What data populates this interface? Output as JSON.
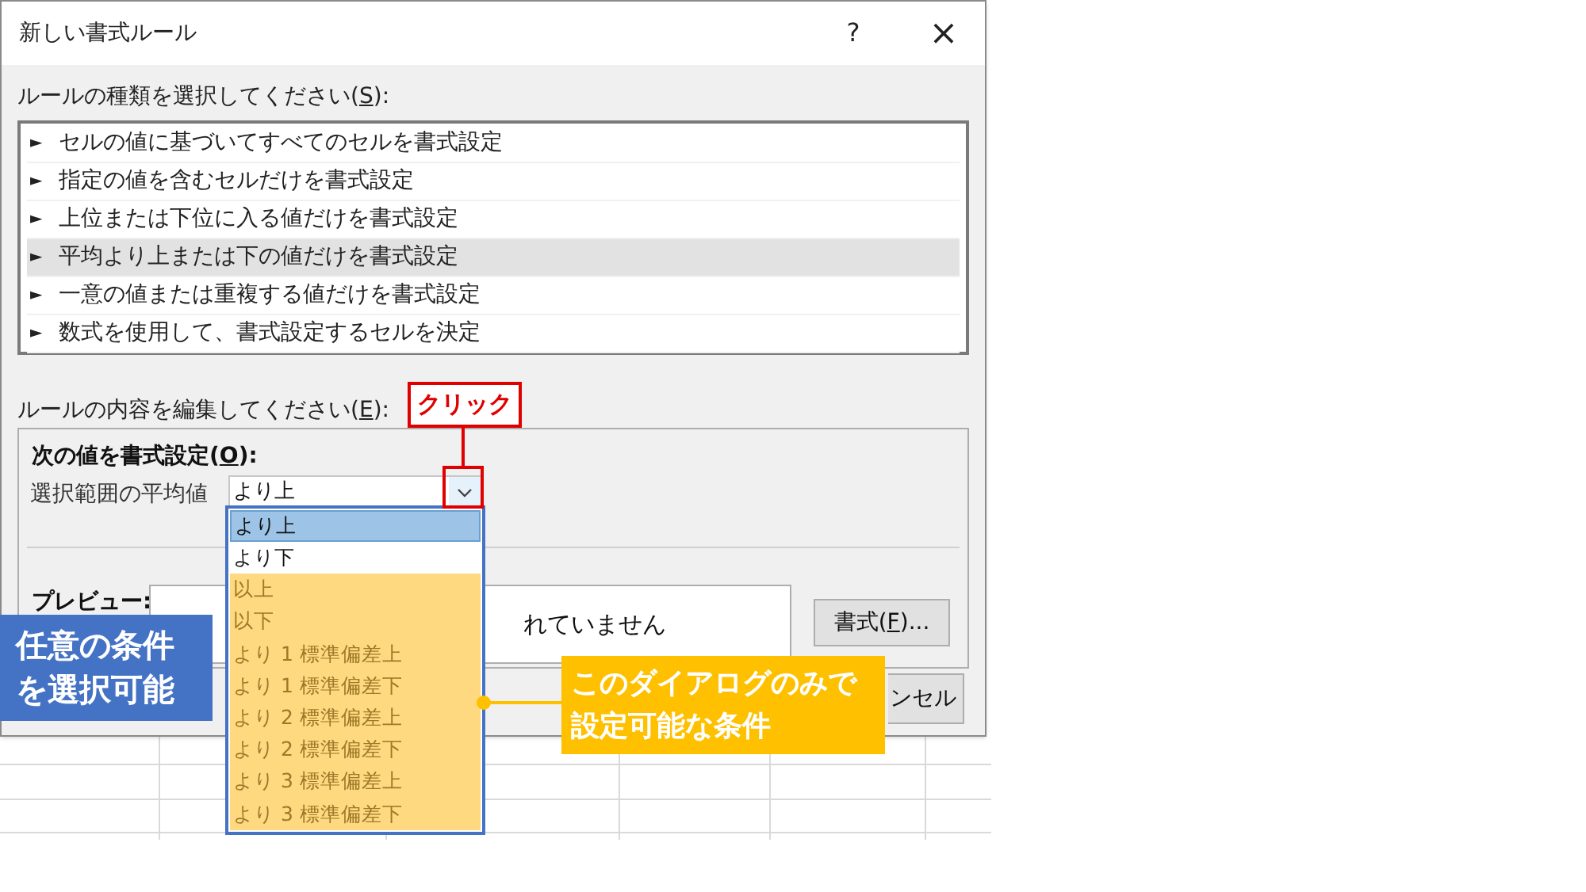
{
  "window": {
    "title": "新しい書式ルール",
    "help": "?",
    "close": "×"
  },
  "rule_type": {
    "label": {
      "before": "ルールの種類を選択してください(",
      "key": "S",
      "after": "):"
    },
    "items": [
      {
        "marker": "►",
        "text": "セルの値に基づいてすべてのセルを書式設定",
        "selected": false
      },
      {
        "marker": "►",
        "text": "指定の値を含むセルだけを書式設定",
        "selected": false
      },
      {
        "marker": "►",
        "text": "上位または下位に入る値だけを書式設定",
        "selected": false
      },
      {
        "marker": "►",
        "text": "平均より上または下の値だけを書式設定",
        "selected": true
      },
      {
        "marker": "►",
        "text": "一意の値または重複する値だけを書式設定",
        "selected": false
      },
      {
        "marker": "►",
        "text": "数式を使用して、書式設定するセルを決定",
        "selected": false
      }
    ]
  },
  "rule_edit": {
    "label": {
      "before": "ルールの内容を編集してください(",
      "key": "E",
      "after": "):"
    },
    "heading": {
      "before": "次の値を書式設定(",
      "key": "O",
      "after": "):"
    },
    "field_label": "選択範囲の平均値",
    "combo_value": "より上",
    "options": [
      {
        "text": "より上",
        "selected": true,
        "kind": "standard"
      },
      {
        "text": "より下",
        "selected": false,
        "kind": "standard"
      },
      {
        "text": "以上",
        "selected": false,
        "kind": "dialog_only"
      },
      {
        "text": "以下",
        "selected": false,
        "kind": "dialog_only"
      },
      {
        "text": "より 1 標準偏差上",
        "selected": false,
        "kind": "dialog_only"
      },
      {
        "text": "より 1 標準偏差下",
        "selected": false,
        "kind": "dialog_only"
      },
      {
        "text": "より 2 標準偏差上",
        "selected": false,
        "kind": "dialog_only"
      },
      {
        "text": "より 2 標準偏差下",
        "selected": false,
        "kind": "dialog_only"
      },
      {
        "text": "より 3 標準偏差上",
        "selected": false,
        "kind": "dialog_only"
      },
      {
        "text": "より 3 標準偏差下",
        "selected": false,
        "kind": "dialog_only"
      }
    ],
    "preview_label": "プレビュー:",
    "preview_text": "れていません",
    "format_button": {
      "before": "書式(",
      "key": "F",
      "after": ")..."
    }
  },
  "cancel_button": "ンセル",
  "callouts": [
    {
      "kind": "click",
      "text": "クリック"
    },
    {
      "kind": "left",
      "text": "任意の条件を選択可能"
    },
    {
      "kind": "right",
      "text": "このダイアログのみで設定可能な条件"
    }
  ]
}
